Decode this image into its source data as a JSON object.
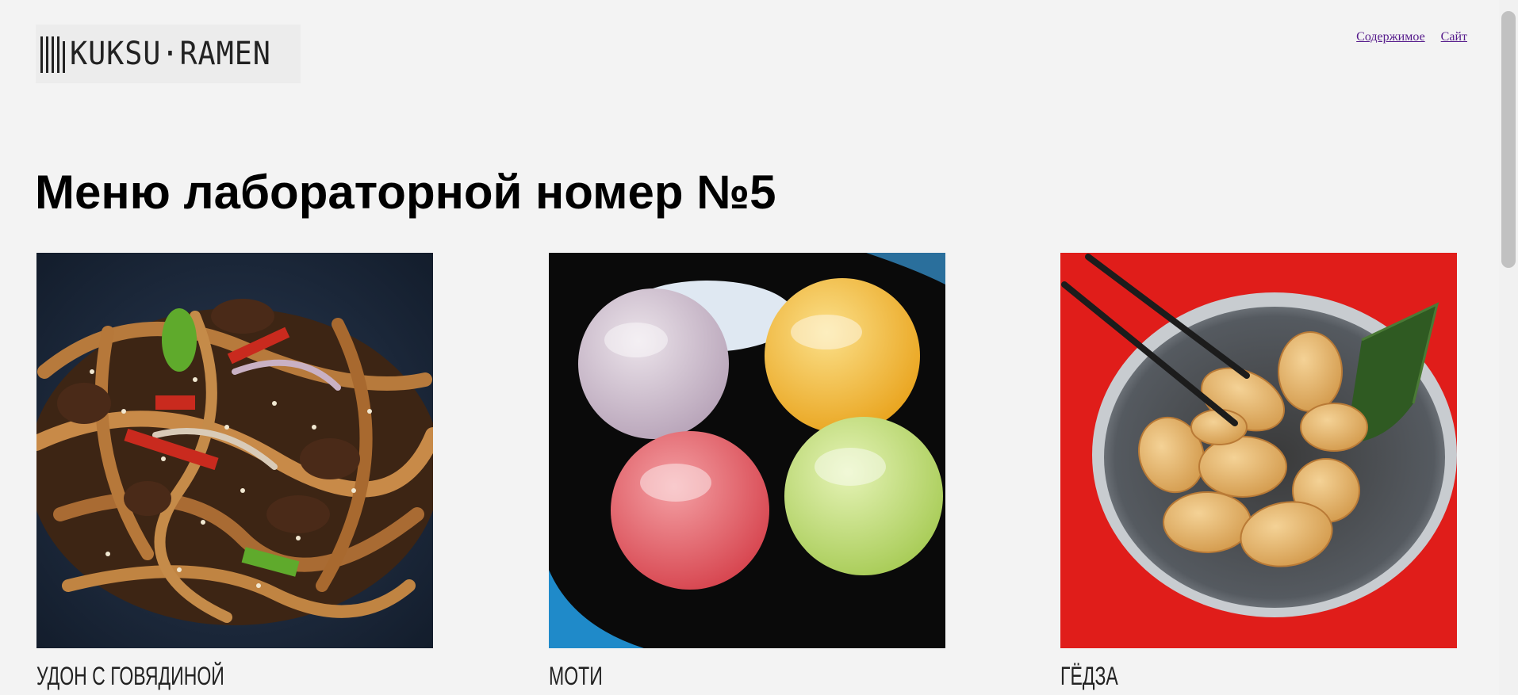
{
  "logo": {
    "text": "KUKSU·RAMEN"
  },
  "nav": [
    {
      "label": "Содержимое"
    },
    {
      "label": "Сайт"
    }
  ],
  "page_title": "Меню лабораторной номер №5",
  "menu_items": [
    {
      "name": "УДОН С ГОВЯДИНОЙ",
      "image": "udon-with-beef"
    },
    {
      "name": "МОТИ",
      "image": "mochi"
    },
    {
      "name": "ГЁДЗА",
      "image": "gyoza"
    }
  ]
}
